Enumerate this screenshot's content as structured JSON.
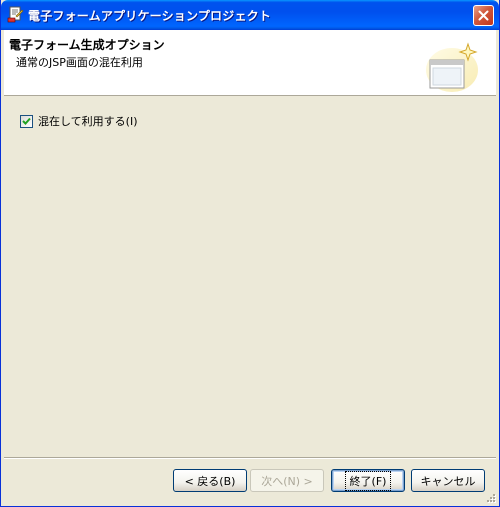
{
  "window": {
    "title": "電子フォームアプリケーションプロジェクト"
  },
  "header": {
    "title": "電子フォーム生成オプション",
    "subtitle": "通常のJSP画面の混在利用"
  },
  "options": {
    "mixed_use": {
      "label": "混在して利用する(I)",
      "checked": true
    }
  },
  "buttons": {
    "back": "< 戻る(B)",
    "next": "次へ(N) >",
    "finish": "終了(F)",
    "cancel": "キャンセル"
  },
  "colors": {
    "titlebar": "#0055ea",
    "close": "#c2351b",
    "face": "#ece9d8"
  }
}
